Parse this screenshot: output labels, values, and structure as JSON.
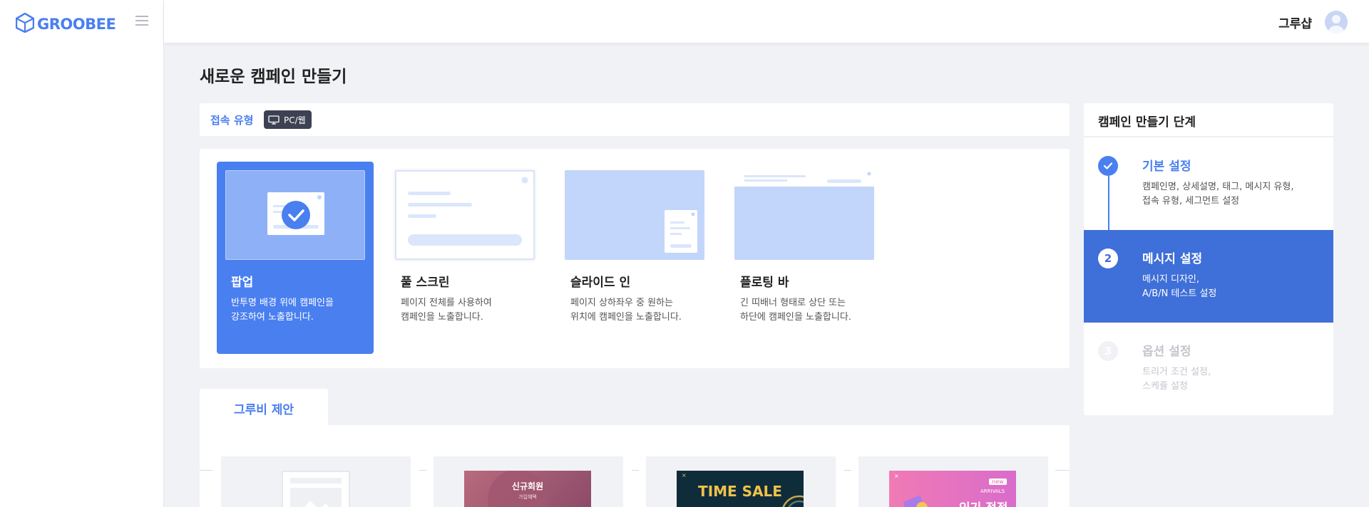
{
  "app": {
    "logo_text": "GROOBEE",
    "user_name": "그루샵"
  },
  "page": {
    "title": "새로운 캠페인 만들기"
  },
  "access": {
    "label": "접속 유형",
    "badge": "PC/웹"
  },
  "types": [
    {
      "title": "팝업",
      "desc1": "반투명 배경 위에 캠페인을",
      "desc2": "강조하여 노출합니다.",
      "selected": true
    },
    {
      "title": "풀 스크린",
      "desc1": "페이지 전체를 사용하여",
      "desc2": "캠페인을 노출합니다.",
      "selected": false
    },
    {
      "title": "슬라이드 인",
      "desc1": "페이지 상하좌우 중 원하는",
      "desc2": "위치에 캠페인을 노출합니다.",
      "selected": false
    },
    {
      "title": "플로팅 바",
      "desc1": "긴 띠배너 형태로 상단 또는",
      "desc2": "하단에 캠페인을 노출합니다.",
      "selected": false
    }
  ],
  "steps": {
    "title": "캠페인 만들기 단계",
    "items": [
      {
        "number": "",
        "name": "기본 설정",
        "desc1": "캠페인명, 상세설명, 태그, 메시지 유형,",
        "desc2": "접속 유형, 세그먼트 설정",
        "state": "done"
      },
      {
        "number": "2",
        "name": "메시지 설정",
        "desc1": "메시지 디자인,",
        "desc2": "A/B/N 테스트 설정",
        "state": "active"
      },
      {
        "number": "3",
        "name": "옵션 설정",
        "desc1": "트리거 조건 설정,",
        "desc2": "스케쥴 설정",
        "state": "pending"
      }
    ]
  },
  "suggestions": {
    "tab_label": "그루비 제안",
    "thumbs": [
      {
        "text": ""
      },
      {
        "text": "신규회원",
        "subtext": "가입혜택"
      },
      {
        "text": "TIME SALE"
      },
      {
        "text": "인기 적정",
        "badge": "new",
        "subtext": "ARRIVALS"
      }
    ]
  },
  "colors": {
    "accent": "#4a7ff0",
    "active_step": "#3f6fd8",
    "preview_bg": "#c2d5fb",
    "badge_bg": "#3d4252"
  }
}
